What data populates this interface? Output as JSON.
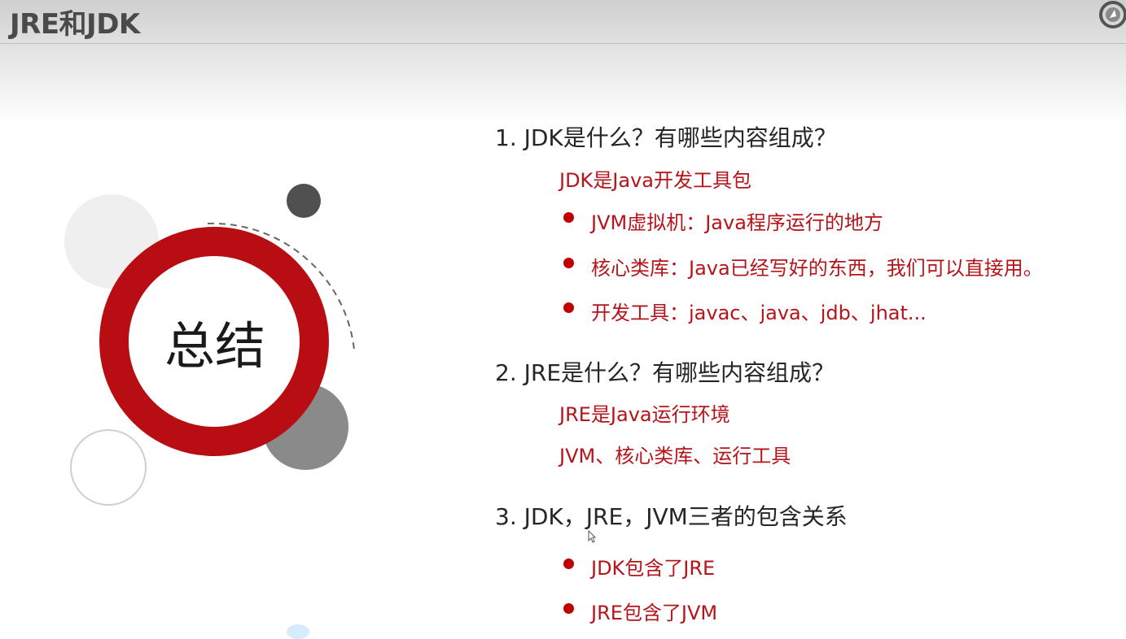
{
  "slide": {
    "title": "JRE和JDK",
    "summary_label": "总结"
  },
  "sections": [
    {
      "question": "1. JDK是什么？有哪些内容组成？",
      "answer": "JDK是Java开发工具包",
      "bullets": [
        "JVM虚拟机：Java程序运行的地方",
        "核心类库：Java已经写好的东西，我们可以直接用。",
        "开发工具：javac、java、jdb、jhat..."
      ]
    },
    {
      "question": "2. JRE是什么？有哪些内容组成？",
      "answers": [
        "JRE是Java运行环境",
        "JVM、核心类库、运行工具"
      ]
    },
    {
      "question": "3. JDK，JRE，JVM三者的包含关系",
      "bullets": [
        "JDK包含了JRE",
        "JRE包含了JVM"
      ]
    }
  ],
  "colors": {
    "accent": "#c00000",
    "answer_text": "#b5141a",
    "question_text": "#262626",
    "dark_circle": "#505050",
    "gray_circle": "#8a8a8a"
  },
  "icons": {
    "logo": "logo-icon",
    "bullet": "bullet-dot-icon",
    "cursor": "mouse-cursor-icon"
  }
}
